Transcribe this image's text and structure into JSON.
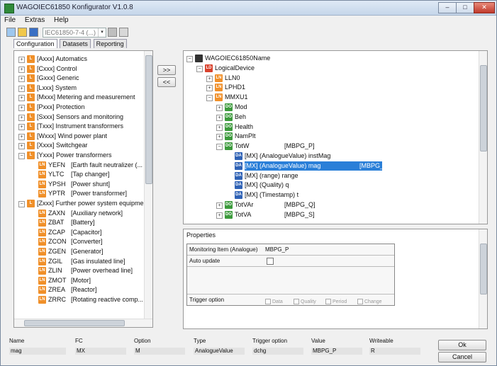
{
  "window": {
    "title": "WAGOIEC61850 Konfigurator V1.0.8",
    "minimize": "–",
    "maximize": "□",
    "close": "✕"
  },
  "menu": [
    "File",
    "Extras",
    "Help"
  ],
  "toolbar": {
    "combo_value": "IEC61850-7-4 (...)",
    "combo_arrow": "▾"
  },
  "tabs": [
    "Configuration",
    "Datasets",
    "Reporting"
  ],
  "left_tree": [
    {
      "label": "[Axxx] Automatics",
      "ln": "L",
      "expander": "+"
    },
    {
      "label": "[Cxxx] Control",
      "ln": "L",
      "expander": "+"
    },
    {
      "label": "[Gxxx] Generic",
      "ln": "L",
      "expander": "+"
    },
    {
      "label": "[Lxxx] System",
      "ln": "L",
      "expander": "+"
    },
    {
      "label": "[Mxxx] Metering and measurement",
      "ln": "L",
      "expander": "+"
    },
    {
      "label": "[Pxxx] Protection",
      "ln": "L",
      "expander": "+"
    },
    {
      "label": "[Sxxx] Sensors and monitoring",
      "ln": "L",
      "expander": "+"
    },
    {
      "label": "[Txxx] Instrument transformers",
      "ln": "L",
      "expander": "+"
    },
    {
      "label": "[Wxxx] Wind power plant",
      "ln": "L",
      "expander": "+"
    },
    {
      "label": "[Xxxx] Switchgear",
      "ln": "L",
      "expander": "+"
    },
    {
      "label": "[Yxxx] Power transformers",
      "ln": "L",
      "expander": "−"
    },
    {
      "label": "YEFN",
      "desc": "[Earth fault neutralizer (...",
      "ln": "LN",
      "child": true
    },
    {
      "label": "YLTC",
      "desc": "[Tap changer]",
      "ln": "LN",
      "child": true
    },
    {
      "label": "YPSH",
      "desc": "[Power shunt]",
      "ln": "LN",
      "child": true
    },
    {
      "label": "YPTR",
      "desc": "[Power transformer]",
      "ln": "LN",
      "child": true
    },
    {
      "label": "[Zxxx] Further power system equipme...",
      "ln": "L",
      "expander": "−"
    },
    {
      "label": "ZAXN",
      "desc": "[Auxiliary network]",
      "ln": "LN",
      "child": true
    },
    {
      "label": "ZBAT",
      "desc": "[Battery]",
      "ln": "LN",
      "child": true
    },
    {
      "label": "ZCAP",
      "desc": "[Capacitor]",
      "ln": "LN",
      "child": true
    },
    {
      "label": "ZCON",
      "desc": "[Converter]",
      "ln": "LN",
      "child": true
    },
    {
      "label": "ZGEN",
      "desc": "[Generator]",
      "ln": "LN",
      "child": true
    },
    {
      "label": "ZGIL",
      "desc": "[Gas insulated line]",
      "ln": "LN",
      "child": true
    },
    {
      "label": "ZLIN",
      "desc": "[Power overhead line]",
      "ln": "LN",
      "child": true
    },
    {
      "label": "ZMOT",
      "desc": "[Motor]",
      "ln": "LN",
      "child": true
    },
    {
      "label": "ZREA",
      "desc": "[Reactor]",
      "ln": "LN",
      "child": true
    },
    {
      "label": "ZRRC",
      "desc": "[Rotating reactive comp...",
      "ln": "LN",
      "child": true
    }
  ],
  "move_buttons": {
    "add": ">>",
    "remove": "<<"
  },
  "right_tree": [
    {
      "label": "WAGOIEC61850Name",
      "ln": "",
      "indent": 0,
      "expander": "−",
      "type": "dev"
    },
    {
      "label": "LogicalDevice",
      "ln": "LD",
      "indent": 1,
      "expander": "−",
      "type": "red"
    },
    {
      "label": "LLN0",
      "ln": "LN",
      "indent": 2,
      "expander": "+",
      "type": "orange"
    },
    {
      "label": "LPHD1",
      "ln": "LN",
      "indent": 2,
      "expander": "+",
      "type": "orange"
    },
    {
      "label": "MMXU1",
      "ln": "LN",
      "indent": 2,
      "expander": "−",
      "type": "orange"
    },
    {
      "label": "Mod",
      "ln": "DO",
      "indent": 3,
      "expander": "+",
      "type": "green"
    },
    {
      "label": "Beh",
      "ln": "DO",
      "indent": 3,
      "expander": "+",
      "type": "green"
    },
    {
      "label": "Health",
      "ln": "DO",
      "indent": 3,
      "expander": "+",
      "type": "green"
    },
    {
      "label": "NamPlt",
      "ln": "DO",
      "indent": 3,
      "expander": "+",
      "type": "green"
    },
    {
      "label": "TotW",
      "col2": "[MBPG_P]",
      "ln": "DO",
      "indent": 3,
      "expander": "−",
      "type": "green"
    },
    {
      "label": "[MX] (AnalogueValue) instMag",
      "ln": "DA",
      "indent": 4,
      "type": "blue"
    },
    {
      "label": "[MX] (AnalogueValue) mag",
      "col2": "[MBPG_P]",
      "ln": "DA",
      "indent": 4,
      "type": "blue",
      "selected": true
    },
    {
      "label": "[MX] (range) range",
      "ln": "DA",
      "indent": 4,
      "type": "blue"
    },
    {
      "label": "[MX] (Quality) q",
      "ln": "DA",
      "indent": 4,
      "type": "blue"
    },
    {
      "label": "[MX] (Timestamp) t",
      "ln": "DA",
      "indent": 4,
      "type": "blue"
    },
    {
      "label": "TotVAr",
      "col2": "[MBPG_Q]",
      "ln": "DO",
      "indent": 3,
      "expander": "+",
      "type": "green"
    },
    {
      "label": "TotVA",
      "col2": "[MBPG_S]",
      "ln": "DO",
      "indent": 3,
      "expander": "+",
      "type": "green"
    }
  ],
  "properties": {
    "title": "Properties",
    "rows": [
      {
        "key": "Monitoring Item (Analogue)",
        "value": "MBPG_P"
      },
      {
        "key": "Auto update",
        "value": ""
      },
      {
        "key": "",
        "value": ""
      },
      {
        "key": "",
        "value": ""
      },
      {
        "key": "Trigger option",
        "value": ""
      }
    ],
    "trigger_options": [
      "Data",
      "Quality",
      "Period",
      "Change"
    ]
  },
  "status": {
    "headers": [
      "Name",
      "FC",
      "Option",
      "Type",
      "Trigger option",
      "Value",
      "Writeable"
    ],
    "values": [
      "mag",
      "MX",
      "M",
      "AnalogueValue",
      "dchg",
      "MBPG_P",
      "R"
    ]
  },
  "buttons": {
    "ok": "Ok",
    "cancel": "Cancel"
  }
}
